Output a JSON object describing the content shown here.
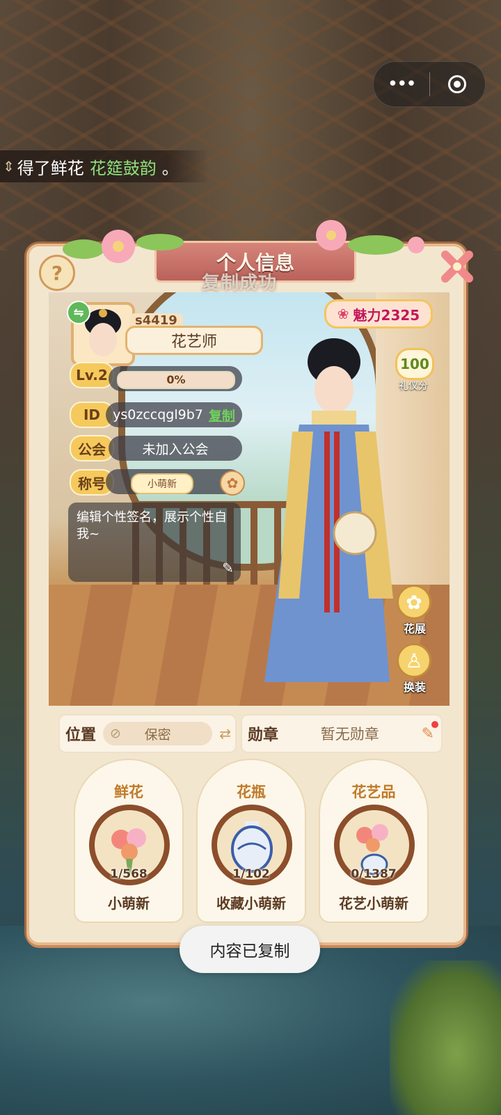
{
  "capsule": {
    "menu_icon": "more-dots-icon",
    "close_icon": "target-circle-icon"
  },
  "marquee": {
    "prefix": "得了鲜花",
    "highlight": "花筵鼓韵",
    "suffix": "。",
    "icon": "scroll-arrows-icon"
  },
  "panel": {
    "title": "个人信息",
    "overlay_text": "复制成功",
    "help_icon": "question-icon",
    "close_icon": "flower-close-icon"
  },
  "profile": {
    "uid": "s4419",
    "name": "花艺师",
    "level_label": "Lv.2",
    "level_progress_text": "0%",
    "level_progress": 0,
    "id_label": "ID",
    "id_value": "ys0zccqgl9b7",
    "copy_label": "复制",
    "guild_label": "公会",
    "guild_value": "未加入公会",
    "honor_label": "称号",
    "honor_value": "小萌新",
    "signature": "编辑个性签名，展示个性自我~"
  },
  "stats": {
    "charm": "魅力2325",
    "etiquette_value": "100",
    "etiquette_label": "礼仪分"
  },
  "side_buttons": {
    "flower_show": "花展",
    "dress_up": "换装"
  },
  "info": {
    "location_label": "位置",
    "location_value": "保密",
    "medal_label": "勋章",
    "medal_value": "暂无勋章"
  },
  "collections": [
    {
      "head": "鲜花",
      "count": "1/568",
      "title": "小萌新"
    },
    {
      "head": "花瓶",
      "count": "1/102",
      "title": "收藏小萌新"
    },
    {
      "head": "花艺品",
      "count": "0/1387",
      "title": "花艺小萌新"
    }
  ],
  "toast": "内容已复制",
  "colors": {
    "accent": "#e5a36a",
    "panel_bg": "#f3e6cf",
    "highlight_green": "#8de07a",
    "copy_green": "#6fd35a"
  }
}
